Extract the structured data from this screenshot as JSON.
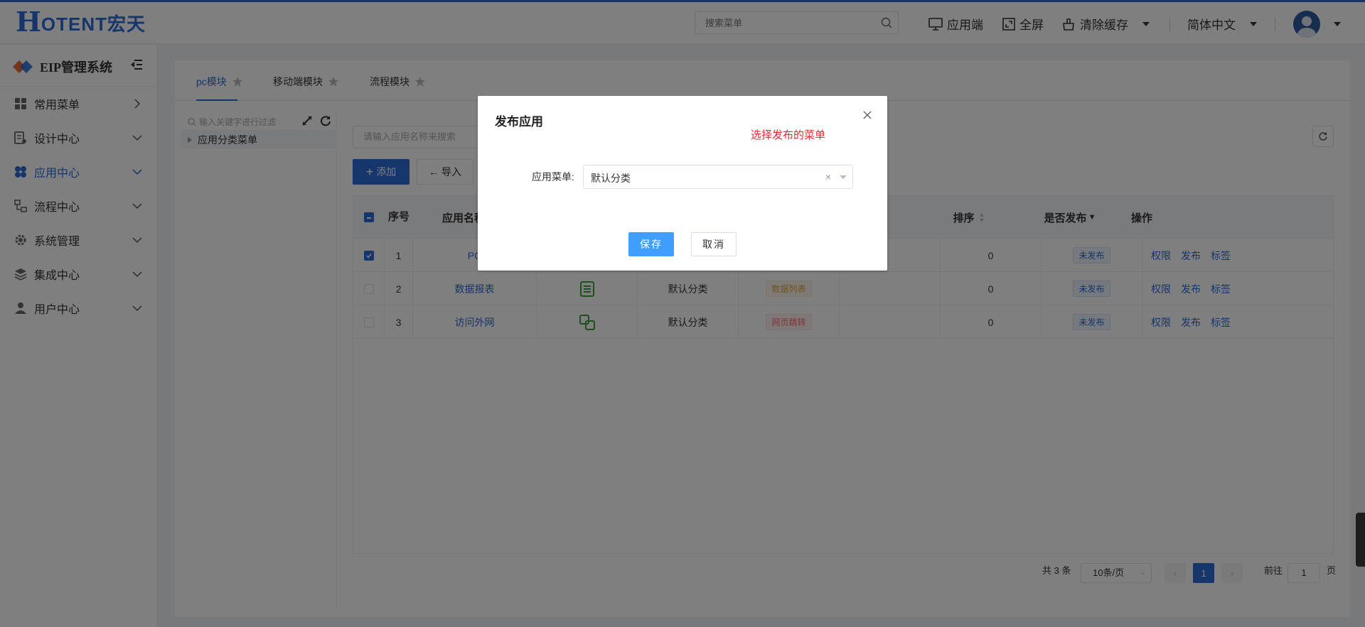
{
  "brand": {
    "logo_h": "H",
    "logo_rest": "OTENT宏天"
  },
  "header": {
    "search_placeholder": "搜索菜单",
    "app_end": "应用端",
    "fullscreen": "全屏",
    "clear_cache": "清除缓存",
    "language": "简体中文"
  },
  "sidebar": {
    "system_title": "EIP管理系统",
    "items": [
      {
        "label": "常用菜单",
        "icon": "grid-icon"
      },
      {
        "label": "设计中心",
        "icon": "design-icon"
      },
      {
        "label": "应用中心",
        "icon": "apps-icon",
        "active": true
      },
      {
        "label": "流程中心",
        "icon": "flow-icon"
      },
      {
        "label": "系统管理",
        "icon": "gear-icon"
      },
      {
        "label": "集成中心",
        "icon": "layers-icon"
      },
      {
        "label": "用户中心",
        "icon": "user-icon"
      }
    ]
  },
  "tabs": [
    "pc模块",
    "移动端模块",
    "流程模块"
  ],
  "tree": {
    "filter_placeholder": "输入关键字进行过滤",
    "root": "应用分类菜单"
  },
  "toolbar": {
    "search_placeholder": "请输入应用名称来搜索",
    "add": "添加",
    "import": "导入"
  },
  "table": {
    "headers": {
      "seq": "序号",
      "name": "应用名称",
      "sort": "排序",
      "published": "是否发布",
      "ops": "操作"
    },
    "rows": [
      {
        "seq": "1",
        "name": "PC",
        "category": "",
        "type": "",
        "sort": "0",
        "status": "未发布",
        "checked": true
      },
      {
        "seq": "2",
        "name": "数据报表",
        "category": "默认分类",
        "type": "数据列表",
        "sort": "0",
        "status": "未发布",
        "checked": false
      },
      {
        "seq": "3",
        "name": "访问外网",
        "category": "默认分类",
        "type": "网页跳转",
        "sort": "0",
        "status": "未发布",
        "checked": false
      }
    ],
    "ops": [
      "权限",
      "发布",
      "标签"
    ]
  },
  "pager": {
    "total": "共 3 条",
    "size": "10条/页",
    "current": "1",
    "goto_label": "前往",
    "goto_value": "1",
    "page_unit": "页"
  },
  "dialog": {
    "title": "发布应用",
    "hint": "选择发布的菜单",
    "label": "应用菜单:",
    "value": "默认分类",
    "clear": "×",
    "save": "保存",
    "cancel": "取消"
  },
  "colors": {
    "accent": "#2a6bd6",
    "dialog_primary": "#409eff",
    "hint": "#f5222d"
  }
}
